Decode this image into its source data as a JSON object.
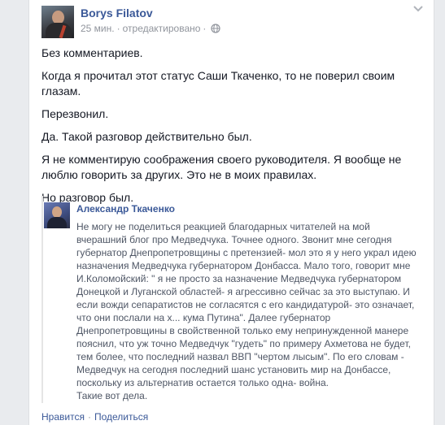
{
  "post": {
    "author": "Borys Filatov",
    "time": "25 мин.",
    "separator": "·",
    "edited": "отредактировано",
    "separator2": "·",
    "privacy_icon": "globe-icon",
    "options_icon": "chevron-down-icon",
    "paragraphs": [
      "Без комментариев.",
      "Когда я прочитал этот статус Саши Ткаченко, то не поверил своим глазам.",
      "Перезвонил.",
      "Да. Такой разговор действительно был.",
      "Я не комментирую соображения своего руководителя. Я вообще не люблю говорить за других. Это не в моих правилах.",
      "Но разговор был."
    ]
  },
  "shared": {
    "author": "Александр Ткаченко",
    "text": "Не могу не поделиться реакцией благодарных читателей на мой вчерашний блог про Медведчука. Точнее одного. Звонит мне сегодня губернатор Днепропетровщины с претензией- мол это я у него украл идею назначения Медведчука губернатором Донбасса. Мало того, говорит мне И.Коломойский: \" я не просто за назначение Медведчука губернатором Донецкой и Луганской областей- я агрессивно сейчас за это выступаю. И если вожди сепаратистов не согласятся с его кандидатурой- это означает, что они послали на х... кума Путина\". Далее губернатор Днепропетровщины в свойственной только ему непринужденной манере пояснил, что уж точно Медведчук \"гудеть\" по примеру Ахметова не будет, тем более, что последний назвал ВВП \"чертом лысым\". По его словам - Медведчук на сегодня последний шанс установить мир на Донбассе, поскольку из альтернатив остается только одна- война.\nТакие вот дела."
  },
  "actions": {
    "like": "Нравится",
    "dot": "·",
    "share": "Поделиться"
  },
  "colors": {
    "link": "#3b5998",
    "muted": "#90949c",
    "text": "#141823"
  }
}
